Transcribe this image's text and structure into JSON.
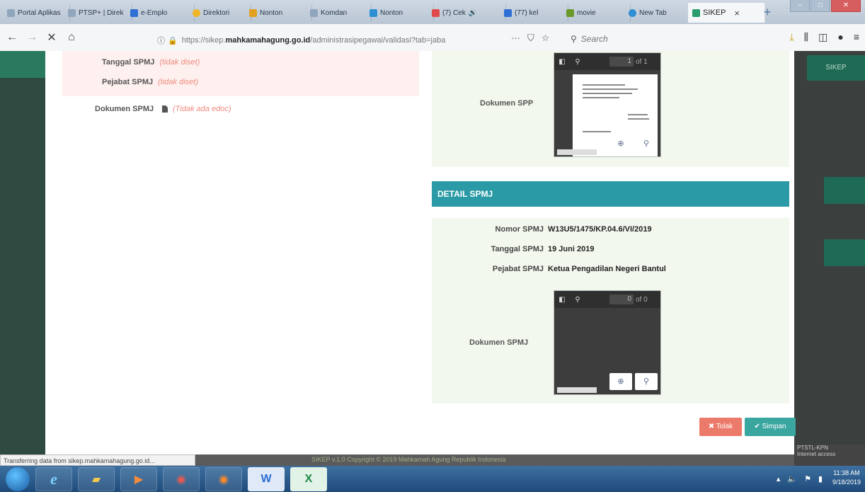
{
  "browser": {
    "tabs": [
      {
        "label": "Portal Aplikas",
        "color": "#8fa6bd"
      },
      {
        "label": "PTSP+ | Direk",
        "color": "#8fa6bd"
      },
      {
        "label": "e-Emplo",
        "color": "#2d6fd4"
      },
      {
        "label": "Direktori",
        "color": "#f0b429"
      },
      {
        "label": "Nonton",
        "color": "#e0a020"
      },
      {
        "label": "Komdan",
        "color": "#8fa6bd"
      },
      {
        "label": "Nonton",
        "color": "#2d8fd4"
      },
      {
        "label": "(7) Cek",
        "color": "#e04a4a"
      },
      {
        "label": "(77) kel",
        "color": "#2d6fd4"
      },
      {
        "label": "movie",
        "color": "#6a9a2a"
      },
      {
        "label": "New Tab",
        "color": "#2d8fd4"
      },
      {
        "label": "SIKEP",
        "color": "#2a9b6a"
      }
    ],
    "active_tab_close": "×",
    "new_tab": "+",
    "window_controls": {
      "minimize": "–",
      "maximize": "□",
      "close": "✕"
    },
    "url": {
      "prefix": "https://sikep.",
      "host": "mahkamahagung.go.id",
      "path": "/administrasipegawai/validasi?tab=jaba"
    },
    "page_actions": "···",
    "search_placeholder": "Search",
    "nav": {
      "back": "←",
      "forward": "→",
      "stop": "✕",
      "home": "⌂"
    }
  },
  "left_panel": {
    "tanggal_label": "Tanggal SPMJ",
    "tanggal_value": "(tidak diset)",
    "pejabat_label": "Pejabat SPMJ",
    "pejabat_value": "(tidak diset)",
    "dokumen_label": "Dokumen SPMJ",
    "dokumen_value": "(Tidak ada edoc)"
  },
  "right_panel": {
    "spp_doc_label": "Dokumen SPP",
    "spp_viewer": {
      "page": "1",
      "of": "of 1"
    },
    "detail_header": "DETAIL SPMJ",
    "detail": [
      {
        "label": "Nomor SPMJ",
        "value": "W13U5/1475/KP.04.6/VI/2019"
      },
      {
        "label": "Tanggal SPMJ",
        "value": "19 Juni 2019"
      },
      {
        "label": "Pejabat SPMJ",
        "value": "Ketua Pengadilan Negeri Bantul"
      }
    ],
    "spmj_doc_label": "Dokumen SPMJ",
    "spmj_viewer": {
      "page": "0",
      "of": "of 0"
    }
  },
  "actions": {
    "reject": "✖ Tolak",
    "approve": "✔ Simpan"
  },
  "rightbar": {
    "label": "SIKEP"
  },
  "footer_text": "SIKEP v.1.0 Copyright © 2019 Mahkamah Agung Republik Indonesia",
  "status_text": "Transferring data from sikep.mahkamahagung.go.id...",
  "network_tooltip": [
    "PTSTL-KPN",
    "Internet access"
  ],
  "clock": {
    "time": "11:38 AM",
    "date": "9/18/2019"
  }
}
